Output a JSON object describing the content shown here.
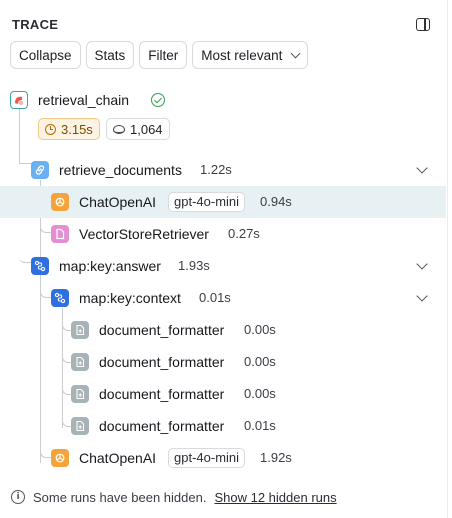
{
  "header": {
    "title": "TRACE",
    "panel_toggle_icon": "sidebar-panel-icon"
  },
  "toolbar": {
    "collapse": "Collapse",
    "stats": "Stats",
    "filter": "Filter",
    "sort": "Most relevant"
  },
  "root": {
    "name": "retrieval_chain",
    "status_icon": "check-circle-icon",
    "latency": "3.15s",
    "tokens": "1,064"
  },
  "runs": [
    {
      "name": "retrieve_documents",
      "latency": "1.22s",
      "icon": "link-icon",
      "color": "#6ab0f3"
    },
    {
      "name": "ChatOpenAI",
      "tag": "gpt-4o-mini",
      "latency": "0.94s",
      "icon": "openai-icon",
      "color": "#f5a33b"
    },
    {
      "name": "VectorStoreRetriever",
      "latency": "0.27s",
      "icon": "document-icon",
      "color": "#e48fd2"
    },
    {
      "name": "map:key:answer",
      "latency": "1.93s",
      "icon": "flow-icon",
      "color": "#2f6fe0"
    },
    {
      "name": "map:key:context",
      "latency": "0.01s",
      "icon": "flow-icon",
      "color": "#2f6fe0"
    },
    {
      "name": "document_formatter",
      "latency": "0.00s",
      "icon": "function-icon",
      "color": "#a8b3b8"
    },
    {
      "name": "document_formatter",
      "latency": "0.00s",
      "icon": "function-icon",
      "color": "#a8b3b8"
    },
    {
      "name": "document_formatter",
      "latency": "0.00s",
      "icon": "function-icon",
      "color": "#a8b3b8"
    },
    {
      "name": "document_formatter",
      "latency": "0.01s",
      "icon": "function-icon",
      "color": "#a8b3b8"
    },
    {
      "name": "ChatOpenAI",
      "tag": "gpt-4o-mini",
      "latency": "1.92s",
      "icon": "openai-icon",
      "color": "#f5a33b"
    }
  ],
  "footer": {
    "message": "Some runs have been hidden.",
    "link": "Show 12 hidden runs"
  }
}
